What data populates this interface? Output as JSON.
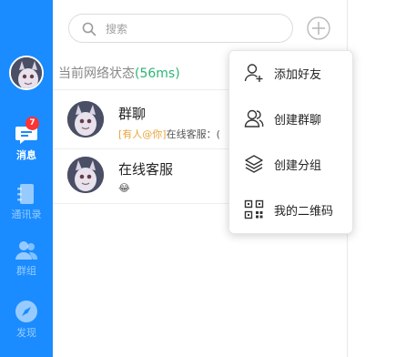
{
  "nav": {
    "badge_count": "7",
    "items": [
      {
        "label": "消息",
        "icon": "chat-bubble-icon"
      },
      {
        "label": "通讯录",
        "icon": "contacts-book-icon"
      },
      {
        "label": "群组",
        "icon": "group-users-icon"
      },
      {
        "label": "发现",
        "icon": "compass-icon"
      }
    ]
  },
  "search": {
    "placeholder": "搜索"
  },
  "network": {
    "label": "当前网络状态",
    "latency": "(56ms)"
  },
  "conversations": [
    {
      "name": "群聊",
      "mention": "[有人@你]",
      "preview": "在线客服：("
    },
    {
      "name": "在线客服",
      "preview": "😂"
    }
  ],
  "menu": {
    "items": [
      {
        "label": "添加好友",
        "icon": "add-user-icon"
      },
      {
        "label": "创建群聊",
        "icon": "group-chat-icon"
      },
      {
        "label": "创建分组",
        "icon": "layers-icon"
      },
      {
        "label": "我的二维码",
        "icon": "qr-code-icon"
      }
    ]
  },
  "colors": {
    "nav_bg": "#1a8cff",
    "badge": "#ff3333",
    "latency": "#2bb673",
    "mention": "#e8a63c"
  }
}
